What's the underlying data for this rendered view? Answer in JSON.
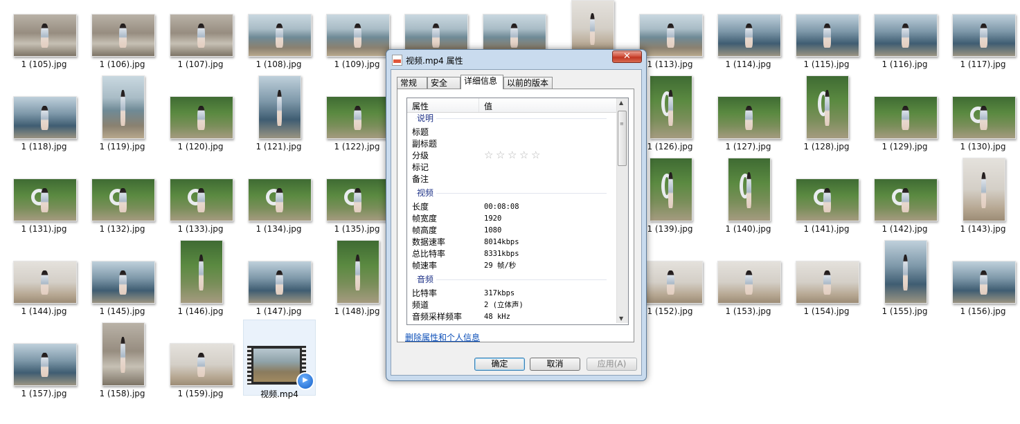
{
  "desktop_files": [
    {
      "name": "1 (105).jpg",
      "style": "rock"
    },
    {
      "name": "1 (106).jpg",
      "style": "rock"
    },
    {
      "name": "1 (107).jpg",
      "style": "rock"
    },
    {
      "name": "1 (108).jpg",
      "style": "beach"
    },
    {
      "name": "1 (109).jpg",
      "style": "beach"
    },
    {
      "name": "",
      "style": "beach"
    },
    {
      "name": "",
      "style": "beach"
    },
    {
      "name": "",
      "style": "fog"
    },
    {
      "name": "1 (113).jpg",
      "style": "beach"
    },
    {
      "name": "1 (114).jpg",
      "style": "sea"
    },
    {
      "name": "1 (115).jpg",
      "style": "sea"
    },
    {
      "name": "1 (116).jpg",
      "style": "sea"
    },
    {
      "name": "1 (117).jpg",
      "style": "sea"
    },
    {
      "name": "1 (118).jpg",
      "style": "sea"
    },
    {
      "name": "1 (119).jpg",
      "style": "beach"
    },
    {
      "name": "1 (120).jpg",
      "style": "green"
    },
    {
      "name": "1 (121).jpg",
      "style": "sea"
    },
    {
      "name": "1 (122).jpg",
      "style": "green"
    },
    {
      "name": "1 (126).jpg",
      "style": "green"
    },
    {
      "name": "1 (127).jpg",
      "style": "green"
    },
    {
      "name": "1 (128).jpg",
      "style": "green"
    },
    {
      "name": "1 (129).jpg",
      "style": "green"
    },
    {
      "name": "1 (130).jpg",
      "style": "green"
    },
    {
      "name": "1 (131).jpg",
      "style": "green"
    },
    {
      "name": "1 (132).jpg",
      "style": "green"
    },
    {
      "name": "1 (133).jpg",
      "style": "green"
    },
    {
      "name": "1 (134).jpg",
      "style": "green"
    },
    {
      "name": "1 (135).jpg",
      "style": "green"
    },
    {
      "name": "1 (139).jpg",
      "style": "green"
    },
    {
      "name": "1 (140).jpg",
      "style": "green"
    },
    {
      "name": "1 (141).jpg",
      "style": "green"
    },
    {
      "name": "1 (142).jpg",
      "style": "green"
    },
    {
      "name": "1 (143).jpg",
      "style": "fog"
    },
    {
      "name": "1 (144).jpg",
      "style": "fog"
    },
    {
      "name": "1 (145).jpg",
      "style": "sea"
    },
    {
      "name": "1 (146).jpg",
      "style": "green"
    },
    {
      "name": "1 (147).jpg",
      "style": "sea"
    },
    {
      "name": "1 (148).jpg",
      "style": "green"
    },
    {
      "name": "1 (152).jpg",
      "style": "fog"
    },
    {
      "name": "1 (153).jpg",
      "style": "fog"
    },
    {
      "name": "1 (154).jpg",
      "style": "fog"
    },
    {
      "name": "1 (155).jpg",
      "style": "sea"
    },
    {
      "name": "1 (156).jpg",
      "style": "sea"
    },
    {
      "name": "1 (157).jpg",
      "style": "sea"
    },
    {
      "name": "1 (158).jpg",
      "style": "rock"
    },
    {
      "name": "1 (159).jpg",
      "style": "fog"
    }
  ],
  "video_file": {
    "name": "视频.mp4"
  },
  "dialog": {
    "title": "视频.mp4 属性",
    "close_icon": "✕",
    "tabs": [
      "常规",
      "安全",
      "详细信息",
      "以前的版本"
    ],
    "active_tab": "详细信息",
    "columns": {
      "property": "属性",
      "value": "值"
    },
    "groups": [
      {
        "name": "说明",
        "rows": [
          {
            "key": "标题",
            "value": ""
          },
          {
            "key": "副标题",
            "value": ""
          },
          {
            "key": "分级",
            "value": "",
            "rating_stars": 0
          },
          {
            "key": "标记",
            "value": ""
          },
          {
            "key": "备注",
            "value": ""
          }
        ]
      },
      {
        "name": "视频",
        "rows": [
          {
            "key": "长度",
            "value": "00:08:08"
          },
          {
            "key": "帧宽度",
            "value": "1920"
          },
          {
            "key": "帧高度",
            "value": "1080"
          },
          {
            "key": "数据速率",
            "value": "8014kbps"
          },
          {
            "key": "总比特率",
            "value": "8331kbps"
          },
          {
            "key": "帧速率",
            "value": "29 帧/秒"
          }
        ]
      },
      {
        "name": "音频",
        "rows": [
          {
            "key": "比特率",
            "value": "317kbps"
          },
          {
            "key": "频道",
            "value": "2 (立体声)"
          },
          {
            "key": "音频采样频率",
            "value": "48 kHz"
          }
        ]
      }
    ],
    "remove_link": "删除属性和个人信息",
    "buttons": {
      "ok": "确定",
      "cancel": "取消",
      "apply": "应用(A)"
    }
  }
}
